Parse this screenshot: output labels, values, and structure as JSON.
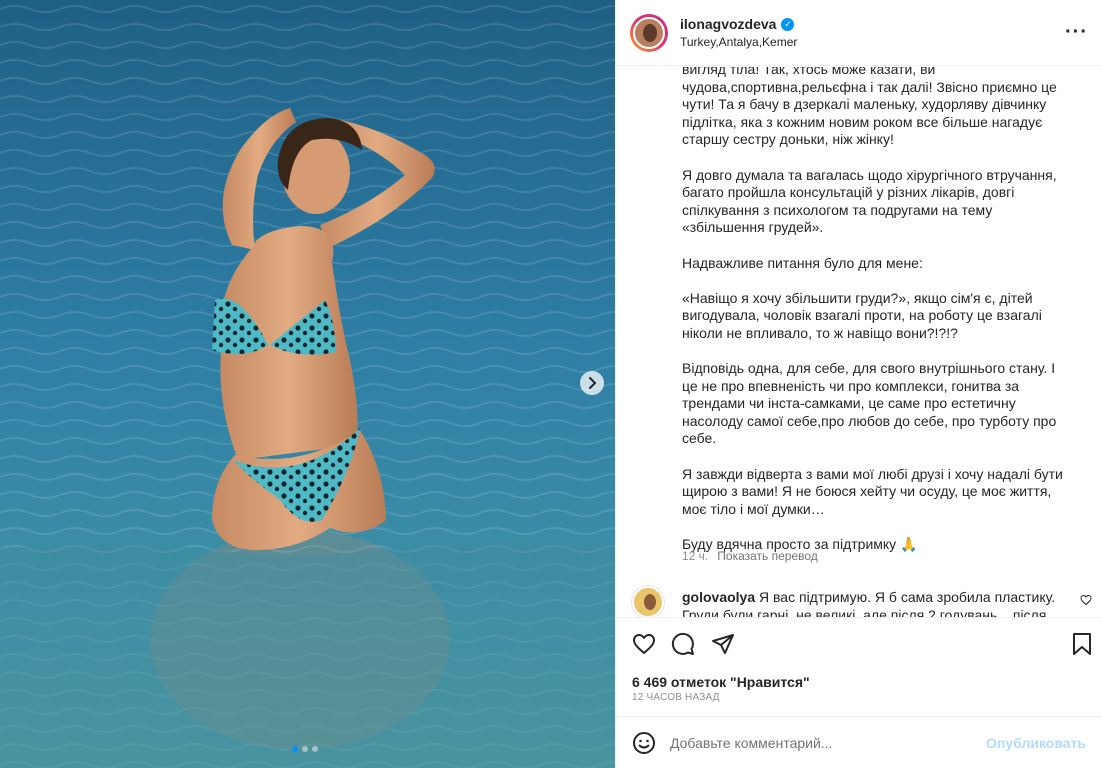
{
  "post": {
    "username": "ilonagvozdeva",
    "verified_icon": "verified-check-icon",
    "location": "Turkey,Antalya,Kemer",
    "caption_paragraphs": [
      "вигляд тіла! Так, хтось може казати, ви чудова,спортивна,рельєфна і так далі! Звісно приємно це чути! Та я бачу в дзеркалі маленьку, худорляву дівчинку підлітка, яка з кожним новим роком все більше нагадує старшу сестру доньки, ніж жінку!",
      "Я довго думала та вагалась щодо хірургічного втручання, багато пройшла консультацій у різних лікарів, довгі спілкування з психологом та подругами на тему «збільшення грудей».",
      "Надважливе питання було для мене:",
      "«Навіщо я хочу збільшити груди?», якщо сім'я є, дітей вигодувала, чоловік взагалі проти, на роботу це взагалі ніколи не впливало, то ж навіщо вони?!?!?",
      "Відповідь одна, для себе, для свого внутрішнього стану. І це не про впевненість чи про комплекси, гонитва за трендами чи інста-самками, це саме про естетичну насолоду самої себе,про любов до себе, про турботу про себе.",
      "Я завжди відверта з вами мої любі друзі і хочу надалі бути щирою з вами! Я не боюся хейту чи осуду, це моє життя, моє тіло і мої думки…",
      "Буду вдячна просто за підтримку 🙏"
    ],
    "caption_age": "12 ч.",
    "translate_label": "Показать перевод",
    "likes_text": "6 469 отметок \"Нравится\"",
    "posted_ago": "12 ЧАСОВ НАЗАД"
  },
  "comment": {
    "username": "golovaolya",
    "text": "Я вас підтримую. Я б сама зробила пластику. Груди були гарні, не великі, але після 2 годувань... після"
  },
  "composer": {
    "placeholder": "Добавьте комментарий...",
    "publish_label": "Опубликовать"
  },
  "carousel": {
    "slide_count": 3,
    "active_index": 0
  },
  "colors": {
    "accent": "#0095f6",
    "publish_disabled": "#b3dbff",
    "muted_text": "#8e8e8e"
  }
}
